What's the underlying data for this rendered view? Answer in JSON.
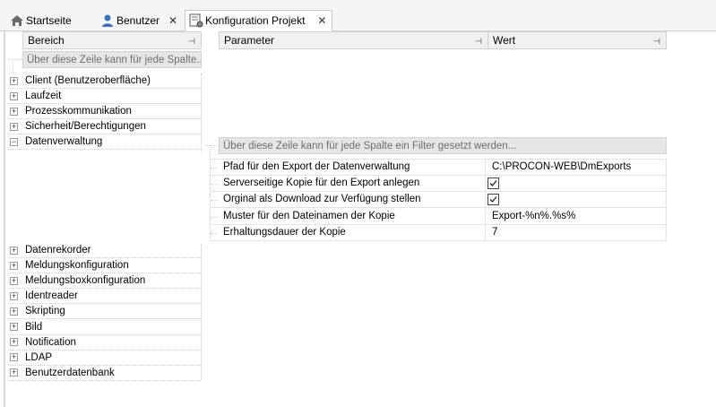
{
  "tabs": [
    {
      "label": "Startseite",
      "icon": "home-icon",
      "closable": false,
      "active": false
    },
    {
      "label": "Benutzer",
      "icon": "user-icon",
      "closable": true,
      "active": false
    },
    {
      "label": "Konfiguration Projekt",
      "icon": "config-gear-icon",
      "closable": true,
      "active": true
    }
  ],
  "tree": {
    "header": "Bereich",
    "filter_placeholder": "Über diese Zeile kann für jede Spalte...",
    "items_before": [
      "Client (Benutzeroberfläche)",
      "Laufzeit",
      "Prozesskommunikation",
      "Sicherheit/Berechtigungen",
      "Datenverwaltung"
    ],
    "items_after": [
      "Datenrekorder",
      "Meldungskonfiguration",
      "Meldungsboxkonfiguration",
      "Identreader",
      "Skripting",
      "Bild",
      "Notification",
      "LDAP",
      "Benutzerdatenbank"
    ]
  },
  "params": {
    "header_parameter": "Parameter",
    "header_wert": "Wert",
    "filter_placeholder": "Über diese Zeile kann für jede Spalte ein Filter gesetzt werden...",
    "rows": [
      {
        "name": "Pfad für den Export der Datenverwaltung",
        "value": "C:\\PROCON-WEB\\DmExports",
        "checkbox": false
      },
      {
        "name": "Serverseitige Kopie für den Export anlegen",
        "value": "",
        "checkbox": true
      },
      {
        "name": "Orginal als Download zur Verfügung stellen",
        "value": "",
        "checkbox": true
      },
      {
        "name": "Muster für den Dateinamen der Kopie",
        "value": "Export-%n%.%s%",
        "checkbox": false
      },
      {
        "name": "Erhaltungsdauer der Kopie",
        "value": "7",
        "checkbox": false
      }
    ]
  }
}
